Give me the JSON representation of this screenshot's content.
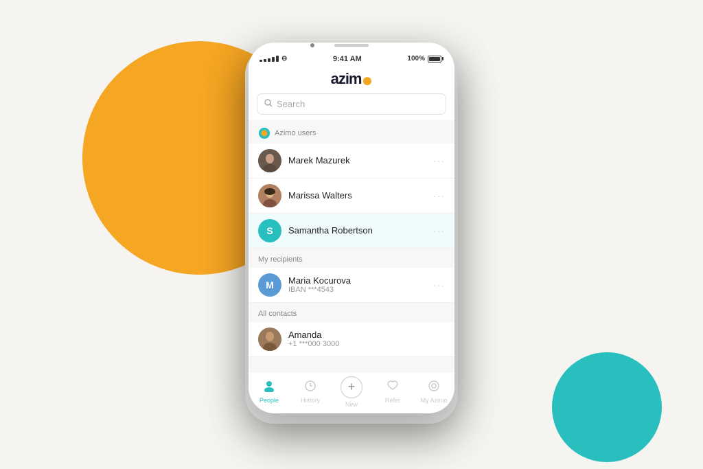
{
  "background": {
    "color": "#f5f4f0",
    "circle_yellow": "#F5A623",
    "circle_teal": "#2ABFBF"
  },
  "status_bar": {
    "time": "9:41 AM",
    "battery": "100%",
    "signal": "●●●●●"
  },
  "header": {
    "logo": "azimo"
  },
  "search": {
    "placeholder": "Search"
  },
  "sections": [
    {
      "id": "azimo-users",
      "title": "Azimo users",
      "contacts": [
        {
          "name": "Marek Mazurek",
          "avatar_letter": null,
          "avatar_type": "photo",
          "avatar_bg": "#6a5a4e"
        },
        {
          "name": "Marissa Walters",
          "avatar_letter": null,
          "avatar_type": "photo",
          "avatar_bg": "#c9a87c"
        },
        {
          "name": "Samantha Robertson",
          "avatar_letter": "S",
          "avatar_type": "letter",
          "avatar_bg": "#2ABFBF"
        }
      ]
    },
    {
      "id": "my-recipients",
      "title": "My recipients",
      "contacts": [
        {
          "name": "Maria Kocurova",
          "sub": "IBAN ***4543",
          "avatar_letter": "M",
          "avatar_type": "letter",
          "avatar_bg": "#5B9BD5"
        }
      ]
    },
    {
      "id": "all-contacts",
      "title": "All contacts",
      "contacts": [
        {
          "name": "Amanda",
          "sub": "+1 ***000 3000",
          "avatar_letter": null,
          "avatar_type": "photo",
          "avatar_bg": "#8B7355"
        }
      ]
    }
  ],
  "bottom_nav": [
    {
      "id": "people",
      "label": "People",
      "icon": "👤",
      "active": true
    },
    {
      "id": "history",
      "label": "History",
      "icon": "🕐",
      "active": false
    },
    {
      "id": "new",
      "label": "New",
      "icon": "+",
      "active": false
    },
    {
      "id": "refer",
      "label": "Refer",
      "icon": "♡",
      "active": false
    },
    {
      "id": "my-azimo",
      "label": "My Azimo",
      "icon": "◎",
      "active": false
    }
  ]
}
